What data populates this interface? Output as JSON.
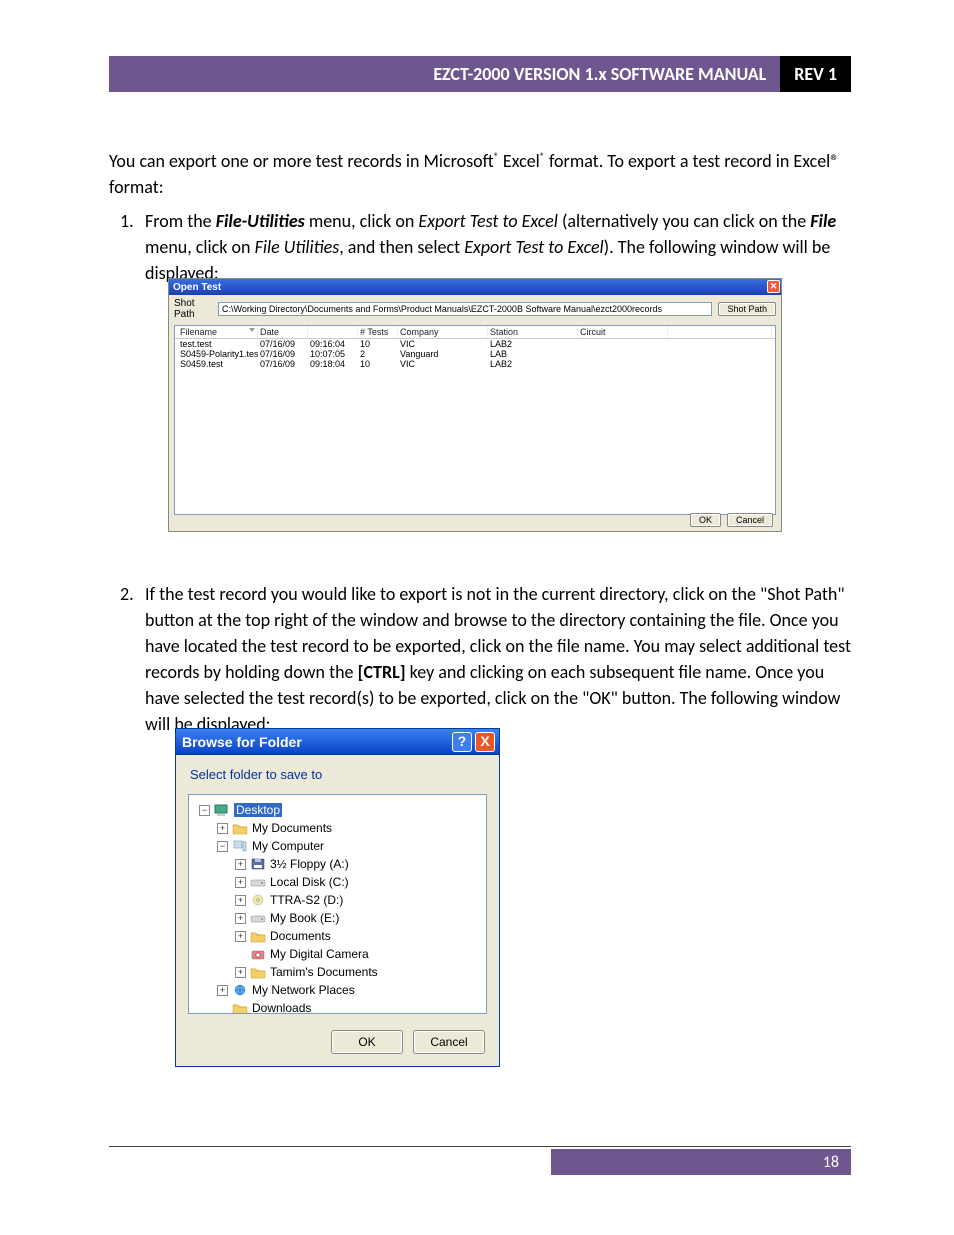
{
  "header": {
    "title": "EZCT-2000 VERSION 1.x SOFTWARE MANUAL",
    "rev": "REV 1"
  },
  "intro": {
    "t1": "You can export one or more test records in Microsoft",
    "t2": " Excel",
    "t3": " format. To export a test record in Excel® format:",
    "sup": "®"
  },
  "step1": {
    "num": "1.",
    "a": "From the ",
    "b": "File-Utilities",
    "c": " menu, click on ",
    "d": "Export Test to Excel",
    "e": " (alternatively you can click on the ",
    "f": "File",
    "g": " menu, click on ",
    "h": "File Utilities",
    "i": ", and then select ",
    "j": "Export Test to Excel",
    "k": "). The following window will be displayed:"
  },
  "open_dialog": {
    "title": "Open Test",
    "path_label": "Shot Path",
    "path_value": "C:\\Working Directory\\Documents and Forms\\Product Manuals\\EZCT-2000B Software Manual\\ezct2000records",
    "shot_path_btn": "Shot Path",
    "columns": [
      "Filename",
      "Date",
      "",
      "# Tests",
      "Company",
      "Station",
      "Circuit",
      ""
    ],
    "rows": [
      {
        "c": [
          "test.test",
          "07/16/09",
          "09:16:04",
          "10",
          "VIC",
          "LAB2",
          "",
          ""
        ]
      },
      {
        "c": [
          "S0459-Polarity1.test",
          "07/16/09",
          "10:07:05",
          "2",
          "Vanguard",
          "LAB",
          "",
          ""
        ]
      },
      {
        "c": [
          "S0459.test",
          "07/16/09",
          "09:18:04",
          "10",
          "VIC",
          "LAB2",
          "",
          ""
        ]
      }
    ],
    "ok": "OK",
    "cancel": "Cancel"
  },
  "step2": {
    "num": "2.",
    "a": "If the test record you would like to export is not in the current directory, click on the \"Shot Path\" button at the top right of the window and browse to the directory containing the file. Once you have located the test record to be exported, click on the file name. You may select additional test records by holding down the ",
    "ctrl": "[CTRL]",
    "b": " key and clicking on each subsequent file name. Once you have selected the test record(s) to be exported, click on the \"OK\" button. The following window will be displayed:"
  },
  "browse_dialog": {
    "title": "Browse for Folder",
    "prompt": "Select folder to save to",
    "tree": [
      {
        "indent": 0,
        "exp": "−",
        "icon": "desktop",
        "label": "Desktop",
        "selected": true
      },
      {
        "indent": 1,
        "exp": "+",
        "icon": "folder",
        "label": "My Documents"
      },
      {
        "indent": 1,
        "exp": "−",
        "icon": "pc",
        "label": "My Computer"
      },
      {
        "indent": 2,
        "exp": "+",
        "icon": "floppy",
        "label": "3½ Floppy (A:)"
      },
      {
        "indent": 2,
        "exp": "+",
        "icon": "drive",
        "label": "Local Disk (C:)"
      },
      {
        "indent": 2,
        "exp": "+",
        "icon": "cd",
        "label": "TTRA-S2 (D:)"
      },
      {
        "indent": 2,
        "exp": "+",
        "icon": "drive",
        "label": "My Book (E:)"
      },
      {
        "indent": 2,
        "exp": "+",
        "icon": "folder",
        "label": "Documents"
      },
      {
        "indent": 2,
        "exp": "",
        "icon": "cam",
        "label": "My Digital Camera"
      },
      {
        "indent": 2,
        "exp": "+",
        "icon": "folder",
        "label": "Tamim's Documents"
      },
      {
        "indent": 1,
        "exp": "+",
        "icon": "globe",
        "label": "My Network Places"
      },
      {
        "indent": 1,
        "exp": "",
        "icon": "folder",
        "label": "Downloads"
      }
    ],
    "ok": "OK",
    "cancel": "Cancel",
    "help": "?",
    "close": "X"
  },
  "footer": {
    "page": "18"
  }
}
